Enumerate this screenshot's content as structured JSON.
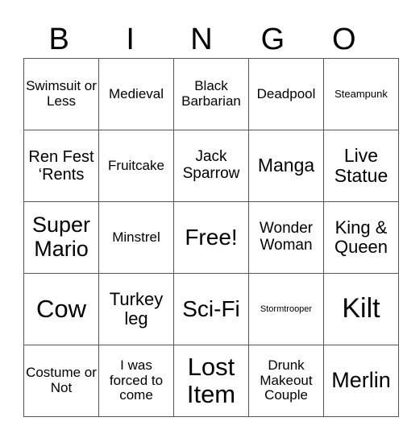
{
  "header": {
    "letters": [
      "B",
      "I",
      "N",
      "G",
      "O"
    ]
  },
  "grid": {
    "rows": [
      [
        "Swimsuit or Less",
        "Medieval",
        "Black Barbarian",
        "Deadpool",
        "Steampunk"
      ],
      [
        "Ren Fest ‘Rents",
        "Fruitcake",
        "Jack Sparrow",
        "Manga",
        "Live Statue"
      ],
      [
        "Super Mario",
        "Minstrel",
        "Free!",
        "Wonder Woman",
        "King & Queen"
      ],
      [
        "Cow",
        "Turkey leg",
        "Sci-Fi",
        "Stormtrooper",
        "Kilt"
      ],
      [
        "Costume or Not",
        "I was forced to come",
        "Lost Item",
        "Drunk Makeout Couple",
        "Merlin"
      ]
    ]
  }
}
